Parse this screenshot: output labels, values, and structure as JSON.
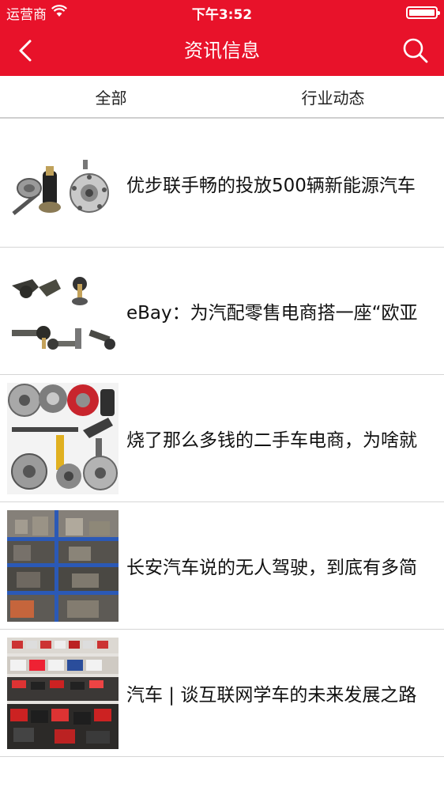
{
  "status_bar": {
    "carrier": "运营商",
    "time": "下午3:52",
    "battery_level": 1.0
  },
  "nav": {
    "title": "资讯信息",
    "back_icon": "chevron-left-icon",
    "search_icon": "search-icon"
  },
  "tabs": [
    {
      "label": "全部"
    },
    {
      "label": "行业动态"
    }
  ],
  "news": [
    {
      "title": "优步联手畅的投放500辆新能源汽车",
      "image": "auto-parts-axles"
    },
    {
      "title": "eBay：为汽配零售电商搭一座“欧亚",
      "image": "auto-parts-ball-joints"
    },
    {
      "title": "烧了那么多钱的二手车电商，为啥就",
      "image": "auto-parts-brakes-clutches"
    },
    {
      "title": "长安汽车说的无人驾驶，到底有多简",
      "image": "auto-parts-warehouse-shelves"
    },
    {
      "title": "汽车 | 谈互联网学车的未来发展之路",
      "image": "auto-parts-store-boxes"
    }
  ],
  "colors": {
    "brand_red": "#e8122a",
    "divider": "#d6d6d6"
  }
}
